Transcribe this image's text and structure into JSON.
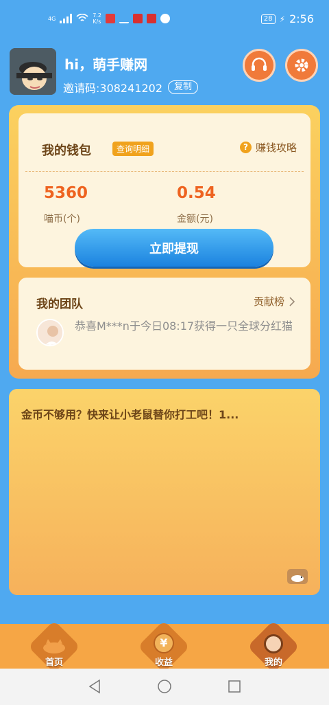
{
  "status_bar": {
    "network": "4G",
    "speed": "7.2\nK/s",
    "battery": "28",
    "time": "2:56"
  },
  "header": {
    "greeting": "hi，萌手赚网",
    "invite_label": "邀请码:308241202",
    "copy_label": "复制"
  },
  "wallet": {
    "title": "我的钱包",
    "detail_label": "查询明细",
    "guide_label": "赚钱攻略",
    "coins_value": "5360",
    "coins_label": "喵币(个)",
    "amount_value": "0.54",
    "amount_label": "金额(元)",
    "withdraw_label": "立即提现"
  },
  "team": {
    "title": "我的团队",
    "rank_label": "贡献榜",
    "message": "恭喜M***n于今日08:17获得一只全球分红猫"
  },
  "game": {
    "text": "金币不够用？快来让小老鼠替你打工吧！1..."
  },
  "tabs": [
    {
      "label": "首页"
    },
    {
      "label": "收益"
    },
    {
      "label": "我的"
    }
  ],
  "colors": {
    "background": "#4fa9f0",
    "accent_orange": "#ee6320",
    "withdraw_blue": "#1b82df"
  }
}
